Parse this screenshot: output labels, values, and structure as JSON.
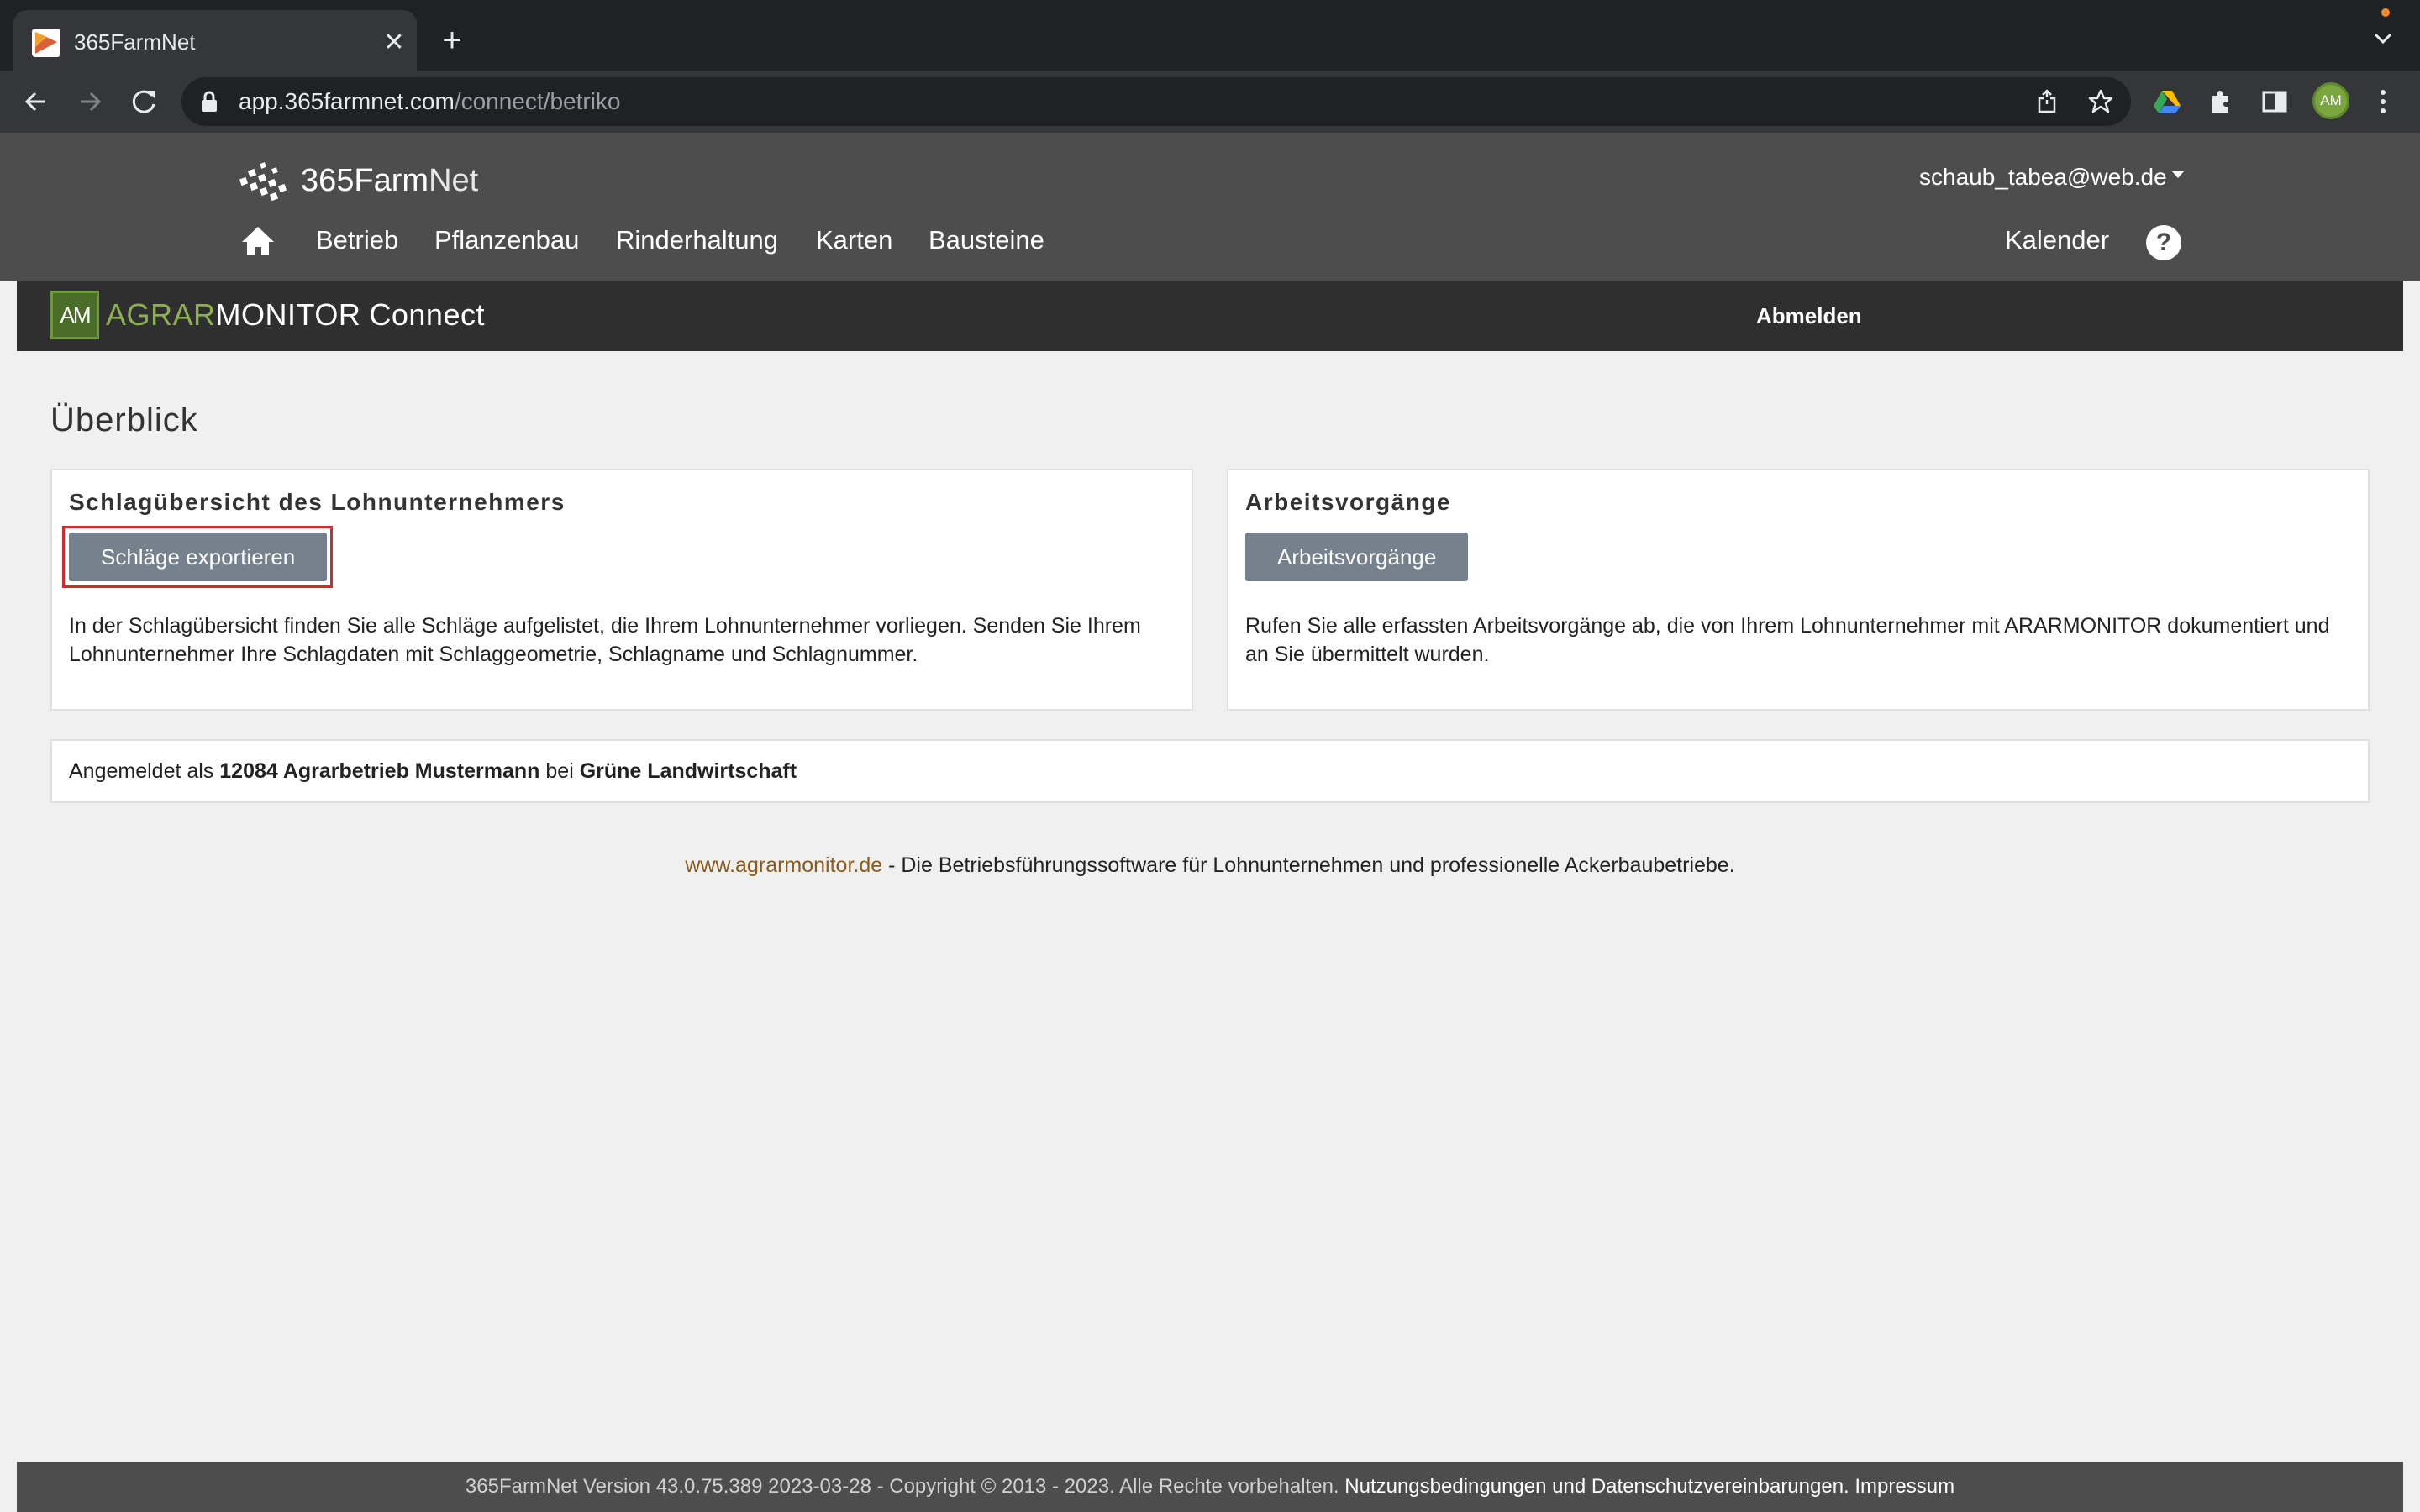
{
  "browser": {
    "tab_title": "365FarmNet",
    "url_domain": "app.365farmnet.com",
    "url_path": "/connect/betriko",
    "profile_initials": "AM"
  },
  "farmnet": {
    "logo_number": "365",
    "logo_farm": "Farm",
    "logo_net": "Net",
    "user": "schaub_tabea@web.de",
    "nav": [
      "Betrieb",
      "Pflanzenbau",
      "Rinderhaltung",
      "Karten",
      "Bausteine"
    ],
    "calendar": "Kalender",
    "help": "?"
  },
  "agrarmonitor": {
    "logo_box": "AM",
    "logo_agrar": "AGRAR",
    "logo_monitor": "MONITOR",
    "logo_connect": "Connect",
    "logout": "Abmelden"
  },
  "main": {
    "title": "Überblick",
    "panels": [
      {
        "heading": "Schlagübersicht des Lohnunternehmers",
        "button": "Schläge exportieren",
        "text": "In der Schlagübersicht finden Sie alle Schläge aufgelistet, die Ihrem Lohnunternehmer vorliegen. Senden Sie Ihrem Lohnunternehmer Ihre Schlagdaten mit Schlaggeometrie, Schlagname und Schlagnummer."
      },
      {
        "heading": "Arbeitsvorgänge",
        "button": "Arbeitsvorgänge",
        "text": "Rufen Sie alle erfassten Arbeitsvorgänge ab, die von Ihrem Lohnunternehmer mit ARARMONITOR dokumentiert und an Sie übermittelt wurden."
      }
    ],
    "login": {
      "prefix": "Angemeldet als",
      "account": "12084 Agrarbetrieb Mustermann",
      "middle": "bei",
      "company": "Grüne Landwirtschaft"
    },
    "footer_link": "www.agrarmonitor.de",
    "footer_text": " - Die Betriebsführungssoftware für Lohnunternehmen und professionelle Ackerbaubetriebe."
  },
  "site_footer": {
    "text": "365FarmNet Version 43.0.75.389 2023-03-28 - Copyright © 2013 - 2023. Alle Rechte vorbehalten.",
    "terms_link": "Nutzungsbedingungen und Datenschutzvereinbarungen.",
    "imprint_link": "Impressum"
  },
  "colors": {
    "highlight": "#d42a2a",
    "button": "#76818e",
    "agrar_green": "#8db050",
    "link": "#8a5a1a"
  }
}
